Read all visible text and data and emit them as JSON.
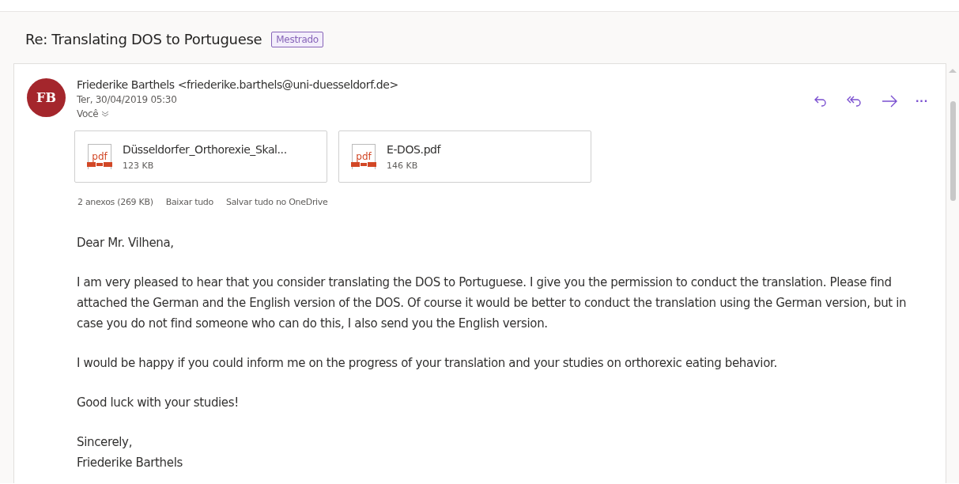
{
  "subject": "Re: Translating DOS to Portuguese",
  "category": {
    "label": "Mestrado",
    "color": "#8764b8"
  },
  "message": {
    "avatar_initials": "FB",
    "sender": "Friederike Barthels <friederike.barthels@uni-duesseldorf.de>",
    "date": "Ter, 30/04/2019 05:30",
    "recipient": "Você",
    "actions": [
      {
        "kind": "reply"
      },
      {
        "kind": "reply-all"
      },
      {
        "kind": "forward"
      },
      {
        "kind": "more",
        "text": "···"
      }
    ],
    "attachments": [
      {
        "name": "Düsseldorfer_Orthorexie_Skal...",
        "size": "123 KB",
        "icon_text": "pdf"
      },
      {
        "name": "E-DOS.pdf",
        "size": "146 KB",
        "icon_text": "pdf"
      }
    ],
    "attachment_summary": "2 anexos (269 KB)",
    "attachment_links": [
      "Baixar tudo",
      "Salvar tudo no OneDrive"
    ],
    "body": [
      "Dear Mr. Vilhena,",
      "I am very pleased to hear that you consider translating the DOS to Portuguese. I give you the permission to conduct the translation. Please find attached the German and the English version of the DOS. Of course it would be better to conduct the translation using the German version, but in case you do not find someone who can do this, I also send you the English version.",
      "I would be happy if you could inform me on the progress of your translation and your studies on orthorexic eating behavior.",
      "Good luck with your studies!",
      "Sincerely,\nFriederike Barthels"
    ]
  }
}
